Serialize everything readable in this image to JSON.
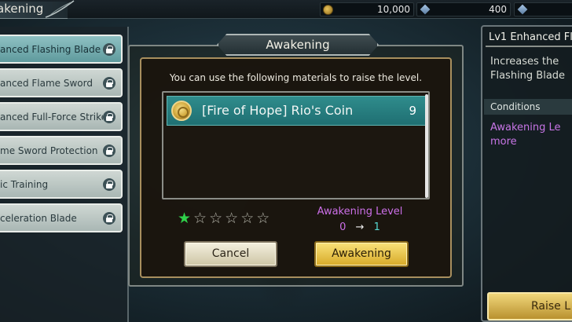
{
  "header": {
    "screen_title": "akening",
    "currencies": [
      {
        "icon": "gold-coin-icon",
        "value": "10,000"
      },
      {
        "icon": "blue-gem-icon",
        "value": "400"
      },
      {
        "icon": "blue-gem-icon",
        "value": ""
      }
    ]
  },
  "skills": [
    {
      "label": "anced Flashing Blade",
      "locked": true,
      "active": true
    },
    {
      "label": "anced Flame Sword",
      "locked": true
    },
    {
      "label": "anced Full-Force Strike",
      "locked": true
    },
    {
      "label": "me Sword Protection",
      "locked": true
    },
    {
      "label": "ic Training",
      "locked": true
    },
    {
      "label": "celeration Blade",
      "locked": true
    }
  ],
  "info": {
    "title": "Lv1 Enhanced Fl",
    "desc_line1": "Increases the",
    "desc_line2": "Flashing Blade",
    "conditions_header": "Conditions",
    "cond_line1": "Awakening Le",
    "cond_line2": "more",
    "raise_label": "Raise L"
  },
  "dialog": {
    "title": "Awakening",
    "instruction": "You can use the following materials to raise the level.",
    "materials": [
      {
        "name": "[Fire of Hope] Rio's Coin",
        "count": "9",
        "icon": "coin-icon"
      }
    ],
    "stars_total": 6,
    "stars_filled": 1,
    "awakening_label": "Awakening Level",
    "level_from": "0",
    "level_arrow": "→",
    "level_to": "1",
    "cancel_label": "Cancel",
    "awaken_label": "Awakening"
  },
  "colors": {
    "star_filled": "#2fd04a",
    "awakening_purple": "#cc6fe8",
    "level_cyan": "#56d8d2",
    "material_row": "#2f8c8c"
  }
}
